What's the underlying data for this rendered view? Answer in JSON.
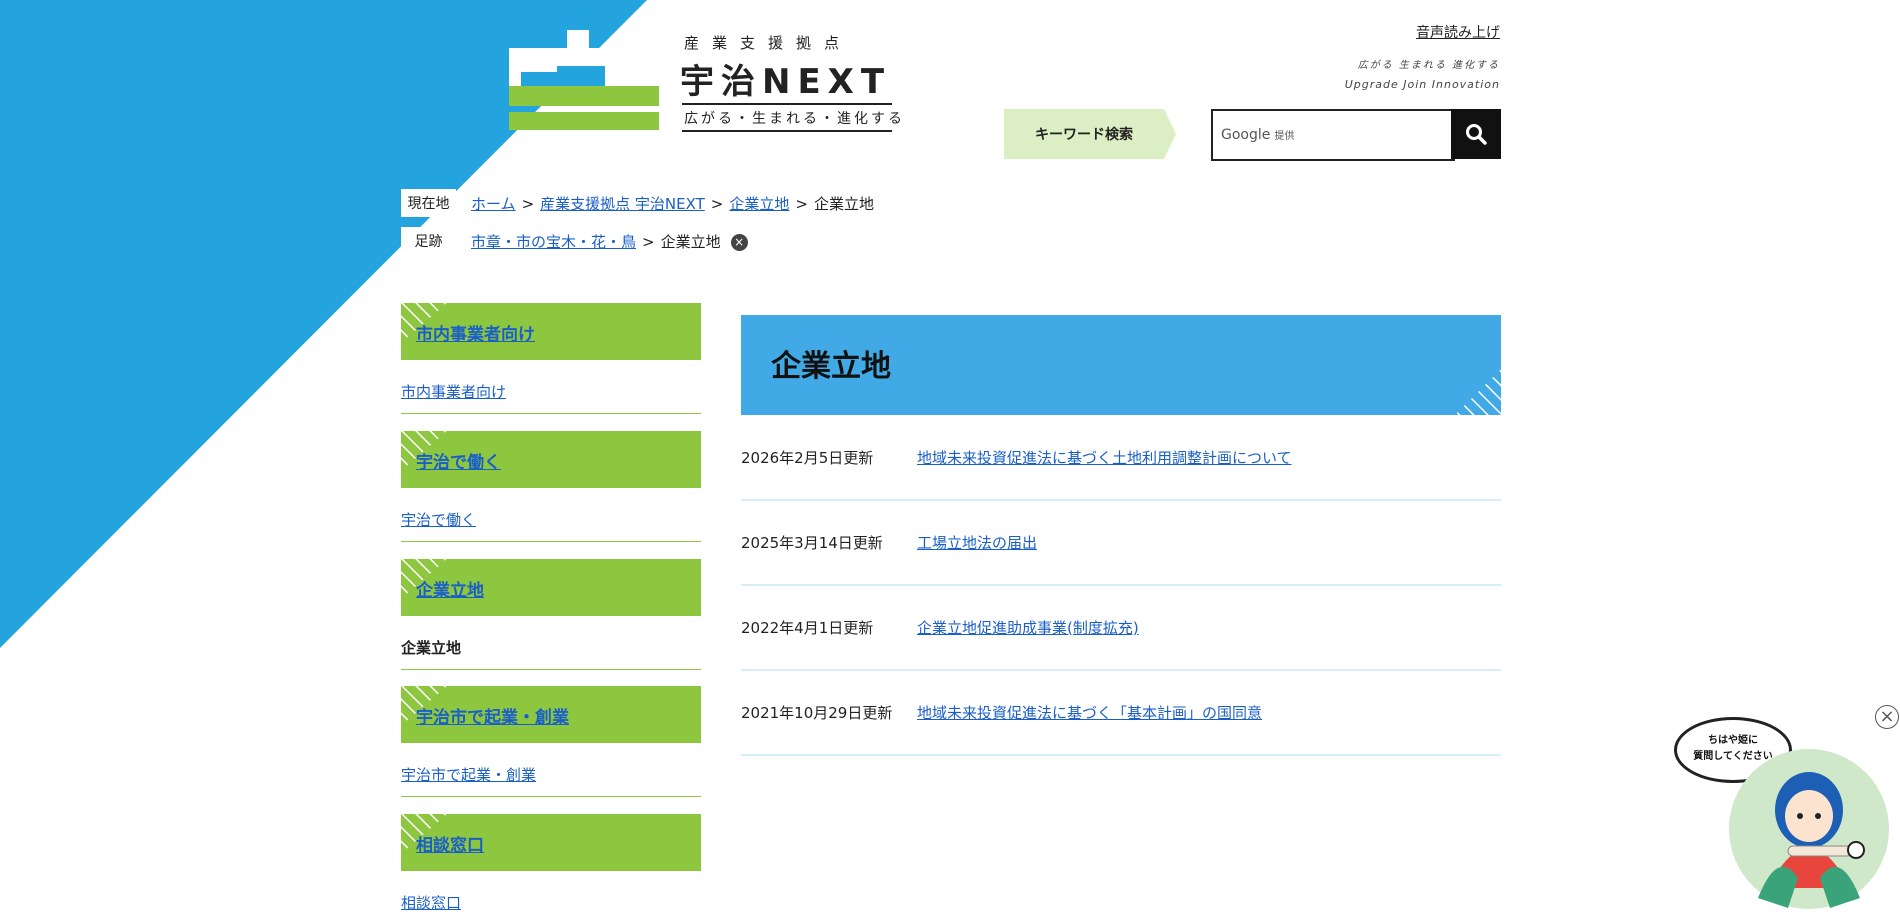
{
  "header": {
    "logo_subtitle": "産業支援拠点",
    "logo_title": "宇治NEXT",
    "logo_tagline": "広がる・生まれる・進化する",
    "voice_link": "音声読み上げ",
    "hand_jp": "広がる 生まれる 進化する",
    "hand_en": "Upgrade Join Innovation"
  },
  "search": {
    "label": "キーワード検索",
    "provider_brand": "Google",
    "provider_suffix": "提供"
  },
  "breadcrumb": {
    "current_label": "現在地",
    "current_items": [
      "ホーム",
      "産業支援拠点 宇治NEXT",
      "企業立地"
    ],
    "current_page": "企業立地",
    "history_label": "足跡",
    "history_items": [
      "市章・市の宝木・花・鳥"
    ],
    "history_page": "企業立地",
    "separator": ">"
  },
  "sidebar": {
    "sections": [
      {
        "heading": "市内事業者向け",
        "sub": "市内事業者向け"
      },
      {
        "heading": "宇治で働く",
        "sub": "宇治で働く"
      },
      {
        "heading": "企業立地",
        "sub": "企業立地"
      },
      {
        "heading": "宇治市で起業・創業",
        "sub": "宇治市で起業・創業"
      },
      {
        "heading": "相談窓口",
        "sub": "相談窓口"
      }
    ]
  },
  "main": {
    "title": "企業立地",
    "news": [
      {
        "date": "2026年2月5日更新",
        "title": "地域未来投資促進法に基づく土地利用調整計画について"
      },
      {
        "date": "2025年3月14日更新",
        "title": "工場立地法の届出"
      },
      {
        "date": "2022年4月1日更新",
        "title": "企業立地促進助成事業(制度拡充)"
      },
      {
        "date": "2021年10月29日更新",
        "title": "地域未来投資促進法に基づく「基本計画」の国同意"
      }
    ]
  },
  "chat": {
    "bubble_line1": "ちはや姫に",
    "bubble_line2": "質問してください",
    "close_glyph": "×"
  },
  "colors": {
    "accent_blue": "#23a4de",
    "title_blue": "#41a9e6",
    "green": "#8dc63f",
    "light_green": "#dcefc4"
  },
  "icons": [
    "search-icon",
    "close-icon",
    "stripes-decoration",
    "mascot-avatar"
  ]
}
